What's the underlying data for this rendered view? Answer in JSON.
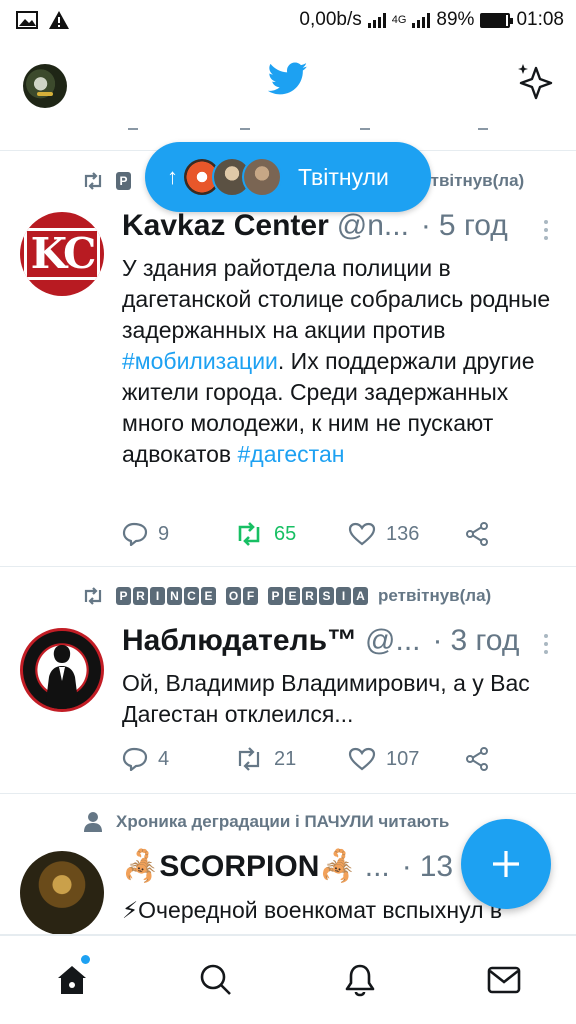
{
  "status_bar": {
    "data_speed": "0,00b/s",
    "network": "4G",
    "battery": "89%",
    "battery_level": 0.89,
    "time": "01:08"
  },
  "new_tweets_pill": {
    "arrow": "↑",
    "label": "Твітнули"
  },
  "tweets": [
    {
      "social_context": "ретвітнув(ла)",
      "social_icon": "retweet-icon",
      "name": "Kavkaz Center",
      "handle": "@n...",
      "dot": "·",
      "time": "5 год",
      "text_before": "У здания райотдела полиции в дагетанской столице собрались родные задержанных на акции против ",
      "hashtag1": "#мобилизации",
      "text_after": ". Их поддержали  другие жители города. Среди задержанных много молодежи, к ним не пускают адвокатов ",
      "hashtag2": "#дагестан",
      "replies": "9",
      "retweets": "65",
      "likes": "136"
    },
    {
      "social_context": "ретвітнув(ла)",
      "social_icon": "retweet-icon",
      "retweeter_letters": [
        "P",
        "R",
        "I",
        "N",
        "C",
        "E",
        " ",
        "O",
        "F",
        " ",
        "P",
        "E",
        "R",
        "S",
        "I",
        "A"
      ],
      "name": "Наблюдатель™",
      "handle": "@...",
      "dot": "·",
      "time": "3 год",
      "text": "Ой, Владимир Владимирович, а у Вас Дагестан отклеился...",
      "replies": "4",
      "retweets": "21",
      "likes": "107"
    },
    {
      "social_context": "Хроника деградации і ПАЧУЛИ читають",
      "social_icon": "person-icon",
      "name": "🦂SCORPION🦂",
      "handle": "...",
      "dot": "·",
      "time": "13",
      "text": "⚡Очередной военкомат вспыхнул в"
    }
  ],
  "colors": {
    "brand": "#1da1f2",
    "retweet_active": "#17bf63",
    "muted": "#657786"
  }
}
